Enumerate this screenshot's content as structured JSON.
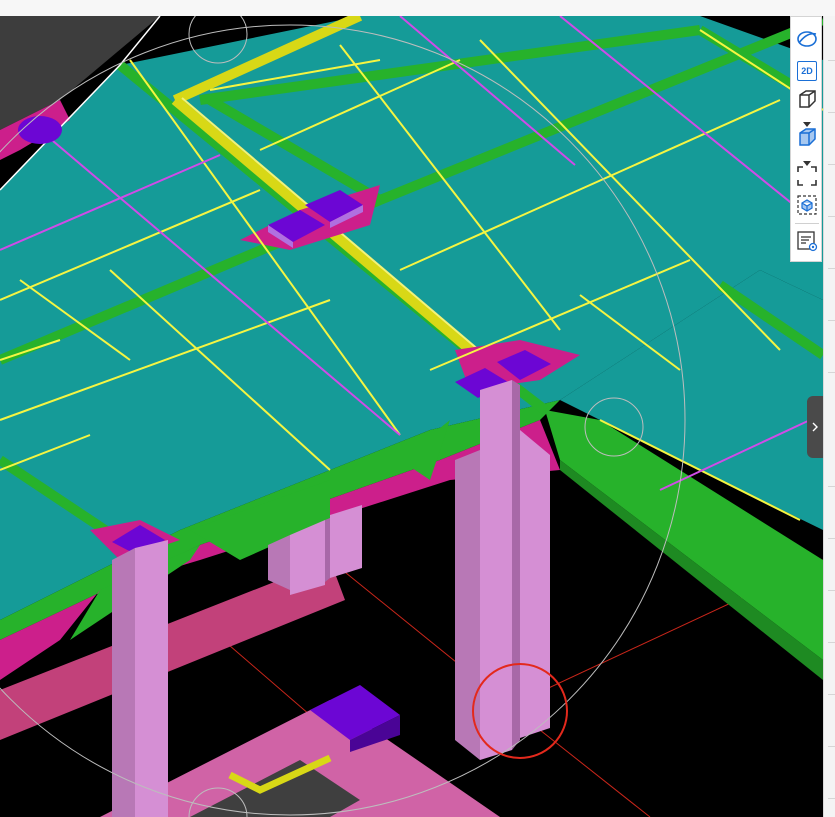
{
  "toolbar": {
    "view_2d_label": "2D",
    "buttons": [
      "orbit-icon",
      "view-2d-icon",
      "wireframe-cube-icon",
      "shaded-cube-icon",
      "fit-view-icon",
      "isolate-icon",
      "properties-icon"
    ]
  },
  "colors": {
    "slab": "#159b98",
    "beam": "#27b22b",
    "joint": "#cc1f8b",
    "column": "#d58fd4",
    "column_cap": "#6c06d4",
    "rebar_yellow": "#f5f542",
    "rebar_magenta": "#d04be8",
    "highlight_beam": "#d8d816",
    "grid_red": "#d02a16",
    "selection_circle": "#e3291c"
  },
  "side_panel": {
    "collapse_icon": "chevron-right-icon"
  }
}
